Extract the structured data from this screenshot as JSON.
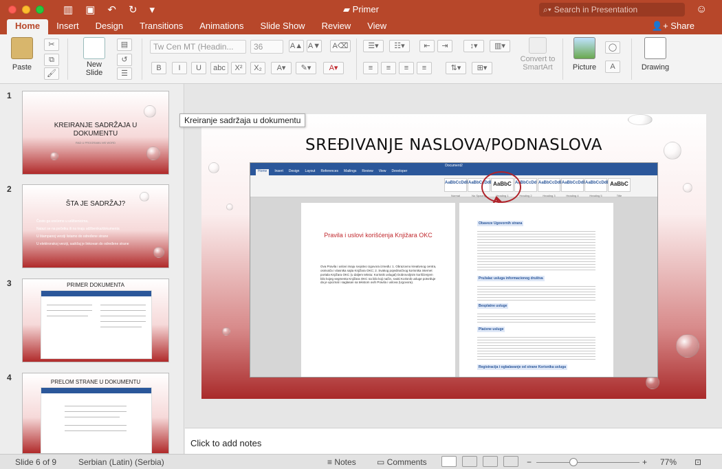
{
  "app": {
    "title": "Primer",
    "search_placeholder": "Search in Presentation",
    "share_label": "Share"
  },
  "tabs": [
    "Home",
    "Insert",
    "Design",
    "Transitions",
    "Animations",
    "Slide Show",
    "Review",
    "View"
  ],
  "ribbon": {
    "paste_label": "Paste",
    "new_slide_label": "New Slide",
    "font_name": "Tw Cen MT (Headin...",
    "font_size": "36",
    "convert_smartart_label": "Convert to SmartArt",
    "picture_label": "Picture",
    "drawing_label": "Drawing",
    "bold": "B",
    "italic": "I",
    "underline": "U",
    "strike": "abc",
    "superscript": "X²",
    "subscript": "X₂"
  },
  "slides": [
    {
      "num": "1",
      "title": "KREIRANJE SADRŽAJA U DOKUMENTU",
      "subtitle": "RAD U PROGRAMU MS WORD"
    },
    {
      "num": "2",
      "title": "ŠTA JE SADRŽAJ?",
      "bullets": [
        "Često ga srećemo u udžbenicima,",
        "Nalazi se na početku ili na kraju udžbenika/dokumenta",
        "U štampanoj verziji listamo do određene strane",
        "U elektronskoj verziji, sadržaj je linkovan do određene strane"
      ]
    },
    {
      "num": "3",
      "title": "PRIMER DOKUMENTA"
    },
    {
      "num": "4",
      "title": "PRELOM STRANE U DOKUMENTU"
    }
  ],
  "tooltip": "Kreiranje sadržaja u dokumentu",
  "main_slide": {
    "title": "SREĐIVANJE NASLOVA/PODNASLOVA",
    "word_tabs": [
      "Home",
      "Insert",
      "Design",
      "Layout",
      "References",
      "Mailings",
      "Review",
      "View",
      "Developer"
    ],
    "word_doc_title": "Document2",
    "word_styles": [
      {
        "sample": "AaBbCcDdEe",
        "name": "Normal"
      },
      {
        "sample": "AaBbCcDdEe",
        "name": "No Spacing"
      },
      {
        "sample": "AaBbC",
        "name": "Heading 1"
      },
      {
        "sample": "AaBbCcDd",
        "name": "Heading 2"
      },
      {
        "sample": "AaBbCcDdE",
        "name": "Heading 3"
      },
      {
        "sample": "AaBbCcDdEe",
        "name": "Heading 4"
      },
      {
        "sample": "AaBbCcDdEe",
        "name": "Heading 5"
      },
      {
        "sample": "AaBbC",
        "name": "Title"
      }
    ],
    "page_left_title": "Pravila i uslovi korišćenja Knjižara OKC",
    "page_left_text": "Ova Pravila i uslovi imaju svojstvo Ugovora između: 1. Obrazovno kreativnog centra, osnivača i vlasnika sajta Knjižara OKC; 2. Svakog pojedinačnog korisnika internet portala Knjižara OKC (u daljem tekstu: Korisnik uslugal) Dobrovoljnim korišćenjem bilo kojeg segmenta Knjižara OKC na bilo koji način, svaki Korisnik usluge potvrđuje da je upoznat i saglasan sa tekstom ovih Pravila i uslova (Ugovora).",
    "page_right_headings": [
      "Obaveze Ugovornih strana",
      "Pružalac usluga informacionog društva",
      "Besplatne usluge",
      "Plaćene usluge",
      "Registracija i ogbalavanje od strane Korisnika usluga"
    ]
  },
  "notes_placeholder": "Click to add notes",
  "status": {
    "slide_of": "Slide 6 of 9",
    "language": "Serbian (Latin) (Serbia)",
    "notes_label": "Notes",
    "comments_label": "Comments",
    "zoom": "77%"
  }
}
